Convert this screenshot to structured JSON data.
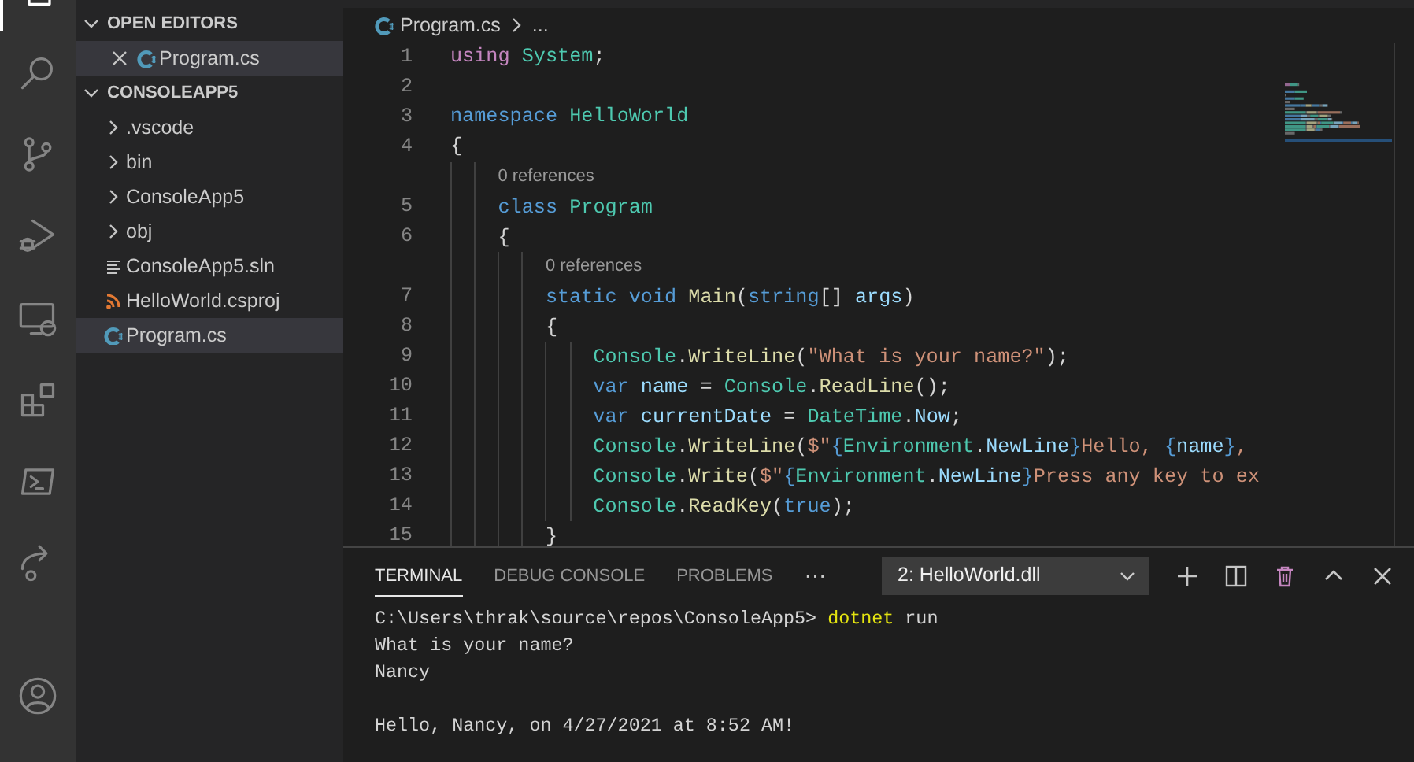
{
  "sidebar": {
    "sections": [
      {
        "title": "OPEN EDITORS",
        "expanded": true,
        "items": [
          {
            "label": "Program.cs",
            "kind": "csharp",
            "selected": true,
            "closable": true
          }
        ]
      },
      {
        "title": "CONSOLEAPP5",
        "expanded": true,
        "items": [
          {
            "label": ".vscode",
            "kind": "folder",
            "expanded": false,
            "selected": false
          },
          {
            "label": "bin",
            "kind": "folder",
            "expanded": false,
            "selected": false
          },
          {
            "label": "ConsoleApp5",
            "kind": "folder",
            "expanded": false,
            "selected": false
          },
          {
            "label": "obj",
            "kind": "folder",
            "expanded": false,
            "selected": false
          },
          {
            "label": "ConsoleApp5.sln",
            "kind": "solution",
            "selected": false
          },
          {
            "label": "HelloWorld.csproj",
            "kind": "project",
            "selected": false
          },
          {
            "label": "Program.cs",
            "kind": "csharp",
            "selected": true
          }
        ]
      }
    ]
  },
  "editor": {
    "breadcrumb": [
      "Program.cs",
      "..."
    ],
    "lines": [
      {
        "kind": "code",
        "number": "1",
        "tokens": [
          {
            "kind": "control",
            "text": "using"
          },
          {
            "kind": "type",
            "text": " System"
          },
          {
            "kind": "plain",
            "text": ";"
          }
        ]
      },
      {
        "kind": "code",
        "number": "2"
      },
      {
        "kind": "code",
        "number": "3",
        "tokens": [
          {
            "kind": "keyword",
            "text": "namespace"
          },
          {
            "kind": "type",
            "text": " HelloWorld"
          }
        ]
      },
      {
        "kind": "code",
        "number": "4",
        "tokens": [
          {
            "kind": "plain",
            "text": "{"
          }
        ]
      },
      {
        "kind": "codelens",
        "text": "0 references"
      },
      {
        "kind": "code",
        "number": "5",
        "tokens": [
          {
            "kind": "keyword",
            "text": "    class"
          },
          {
            "kind": "type",
            "text": " Program"
          }
        ]
      },
      {
        "kind": "code",
        "number": "6",
        "tokens": [
          {
            "kind": "plain",
            "text": "    {"
          }
        ]
      },
      {
        "kind": "codelens",
        "text": "0 references"
      },
      {
        "kind": "code",
        "number": "7",
        "tokens": [
          {
            "kind": "keyword",
            "text": "        static"
          },
          {
            "kind": "keyword",
            "text": " void"
          },
          {
            "kind": "method",
            "text": " Main"
          },
          {
            "kind": "plain",
            "text": "("
          },
          {
            "kind": "keyword",
            "text": "string"
          },
          {
            "kind": "plain",
            "text": "[] "
          },
          {
            "kind": "variable",
            "text": "args"
          },
          {
            "kind": "plain",
            "text": ")"
          }
        ]
      },
      {
        "kind": "code",
        "number": "8",
        "tokens": [
          {
            "kind": "plain",
            "text": "        {"
          }
        ]
      },
      {
        "kind": "code",
        "number": "9",
        "tokens": [
          {
            "kind": "type",
            "text": "            Console"
          },
          {
            "kind": "plain",
            "text": "."
          },
          {
            "kind": "method",
            "text": "WriteLine"
          },
          {
            "kind": "plain",
            "text": "("
          },
          {
            "kind": "string",
            "text": "\"What is your name?\""
          },
          {
            "kind": "plain",
            "text": ");"
          }
        ]
      },
      {
        "kind": "code",
        "number": "10",
        "tokens": [
          {
            "kind": "keyword",
            "text": "            var"
          },
          {
            "kind": "variable",
            "text": " name"
          },
          {
            "kind": "plain",
            "text": " = "
          },
          {
            "kind": "type",
            "text": "Console"
          },
          {
            "kind": "plain",
            "text": "."
          },
          {
            "kind": "method",
            "text": "ReadLine"
          },
          {
            "kind": "plain",
            "text": "();"
          }
        ]
      },
      {
        "kind": "code",
        "number": "11",
        "tokens": [
          {
            "kind": "keyword",
            "text": "            var"
          },
          {
            "kind": "variable",
            "text": " currentDate"
          },
          {
            "kind": "plain",
            "text": " = "
          },
          {
            "kind": "type",
            "text": "DateTime"
          },
          {
            "kind": "plain",
            "text": "."
          },
          {
            "kind": "variable",
            "text": "Now"
          },
          {
            "kind": "plain",
            "text": ";"
          }
        ]
      },
      {
        "kind": "code",
        "number": "12",
        "tokens": [
          {
            "kind": "type",
            "text": "            Console"
          },
          {
            "kind": "plain",
            "text": "."
          },
          {
            "kind": "method",
            "text": "WriteLine"
          },
          {
            "kind": "plain",
            "text": "("
          },
          {
            "kind": "string",
            "text": "$\""
          },
          {
            "kind": "brace",
            "text": "{"
          },
          {
            "kind": "type",
            "text": "Environment"
          },
          {
            "kind": "plain",
            "text": "."
          },
          {
            "kind": "variable",
            "text": "NewLine"
          },
          {
            "kind": "brace",
            "text": "}"
          },
          {
            "kind": "string",
            "text": "Hello, "
          },
          {
            "kind": "brace",
            "text": "{"
          },
          {
            "kind": "variable",
            "text": "name"
          },
          {
            "kind": "brace",
            "text": "}"
          },
          {
            "kind": "string",
            "text": ","
          }
        ]
      },
      {
        "kind": "code",
        "number": "13",
        "tokens": [
          {
            "kind": "type",
            "text": "            Console"
          },
          {
            "kind": "plain",
            "text": "."
          },
          {
            "kind": "method",
            "text": "Write"
          },
          {
            "kind": "plain",
            "text": "("
          },
          {
            "kind": "string",
            "text": "$\""
          },
          {
            "kind": "brace",
            "text": "{"
          },
          {
            "kind": "type",
            "text": "Environment"
          },
          {
            "kind": "plain",
            "text": "."
          },
          {
            "kind": "variable",
            "text": "NewLine"
          },
          {
            "kind": "brace",
            "text": "}"
          },
          {
            "kind": "string",
            "text": "Press any key to ex"
          }
        ]
      },
      {
        "kind": "code",
        "number": "14",
        "tokens": [
          {
            "kind": "type",
            "text": "            Console"
          },
          {
            "kind": "plain",
            "text": "."
          },
          {
            "kind": "method",
            "text": "ReadKey"
          },
          {
            "kind": "plain",
            "text": "("
          },
          {
            "kind": "keyword",
            "text": "true"
          },
          {
            "kind": "plain",
            "text": ");"
          }
        ]
      },
      {
        "kind": "code",
        "number": "15",
        "tokens": [
          {
            "kind": "plain",
            "text": "        }"
          }
        ]
      }
    ]
  },
  "panel": {
    "tabs": [
      {
        "label": "TERMINAL",
        "selected": true
      },
      {
        "label": "DEBUG CONSOLE",
        "selected": false
      },
      {
        "label": "PROBLEMS",
        "selected": false
      }
    ],
    "more": "···",
    "terminal_select": "2: HelloWorld.dll",
    "terminal": [
      {
        "kind": "output",
        "segments": [
          {
            "kind": "plain",
            "text": "C:\\Users\\thrak\\source\\repos\\ConsoleApp5> "
          },
          {
            "kind": "command",
            "text": "dotnet"
          },
          {
            "kind": "plain",
            "text": " run"
          }
        ]
      },
      {
        "kind": "output",
        "segments": [
          {
            "kind": "plain",
            "text": "What is your name?"
          }
        ]
      },
      {
        "kind": "output",
        "segments": [
          {
            "kind": "plain",
            "text": "Nancy"
          }
        ]
      },
      {
        "kind": "blank"
      },
      {
        "kind": "output",
        "segments": [
          {
            "kind": "plain",
            "text": "Hello, Nancy, on 4/27/2021 at 8:52 AM!"
          }
        ]
      }
    ]
  }
}
